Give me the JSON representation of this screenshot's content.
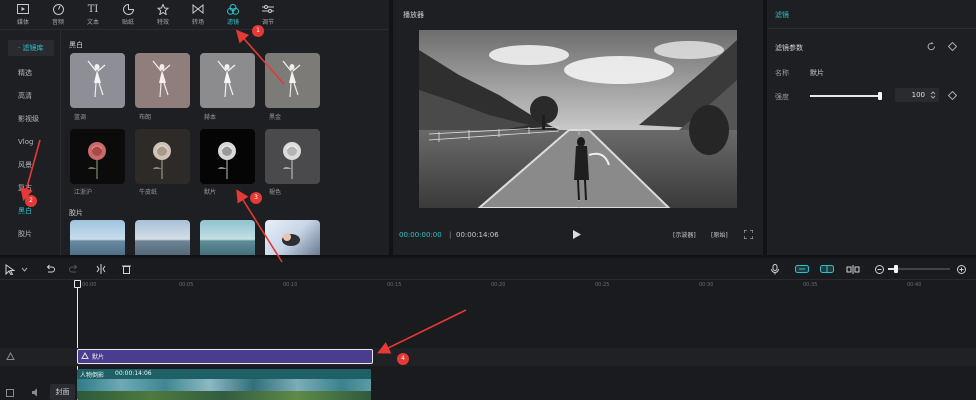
{
  "toolbar": {
    "items": [
      {
        "label": "媒体",
        "icon": "media-icon"
      },
      {
        "label": "音频",
        "icon": "audio-icon"
      },
      {
        "label": "文本",
        "icon": "text-icon"
      },
      {
        "label": "贴纸",
        "icon": "sticker-icon"
      },
      {
        "label": "特效",
        "icon": "effects-icon"
      },
      {
        "label": "转场",
        "icon": "transition-icon"
      },
      {
        "label": "滤镜",
        "icon": "filter-icon"
      },
      {
        "label": "调节",
        "icon": "adjust-icon"
      }
    ],
    "active_index": 6
  },
  "sidebar": {
    "items": [
      {
        "label": "· 滤镜库"
      },
      {
        "label": "精选"
      },
      {
        "label": "高清"
      },
      {
        "label": "影视级"
      },
      {
        "label": "Vlog"
      },
      {
        "label": "风景"
      },
      {
        "label": "复古"
      },
      {
        "label": "黑白"
      },
      {
        "label": "胶片"
      }
    ]
  },
  "filters": {
    "section_bw": "黑白",
    "section_film": "胶片",
    "row1": [
      {
        "label": "蓝调"
      },
      {
        "label": "布朗"
      },
      {
        "label": "赫本"
      },
      {
        "label": "黑金"
      }
    ],
    "row2": [
      {
        "label": "江浙沪"
      },
      {
        "label": "牛皮纸"
      },
      {
        "label": "默片"
      },
      {
        "label": "褪色"
      }
    ]
  },
  "player": {
    "title": "播放器",
    "time_current": "00:00:00:00",
    "time_total": "00:00:14:06",
    "btn_ratio": "[示波器]",
    "btn_orig": "[原始]"
  },
  "props": {
    "title": "滤镜",
    "section": "滤镜参数",
    "name_label": "名称",
    "name_value": "默片",
    "strength_label": "强度",
    "strength_value": "100",
    "strength_fraction": 1.0
  },
  "timeline": {
    "ticks": [
      "00:00",
      "00:05",
      "00:10",
      "00:15",
      "00:20",
      "00:25",
      "00:30",
      "00:35",
      "00:40"
    ],
    "filter_clip_label": "默片",
    "video_clip_label": "人物倒影",
    "video_clip_time": "00:00:14:06",
    "cover_label": "封面"
  },
  "annotations": [
    "1",
    "2",
    "3",
    "4"
  ],
  "colors": {
    "accent": "#2bc2c9",
    "clip_purple": "#4a3d8f",
    "arrow_red": "#e53935"
  }
}
